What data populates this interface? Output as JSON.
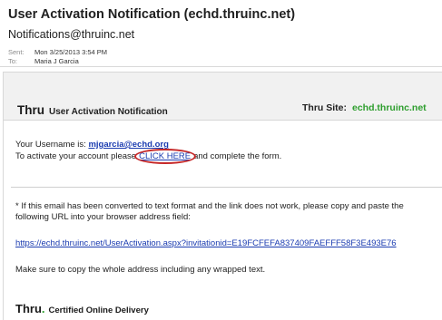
{
  "email": {
    "subject": "User Activation Notification (echd.thruinc.net)",
    "from": "Notifications@thruinc.net",
    "sent_label": "Sent:",
    "sent_value": "Mon 3/25/2013 3:54 PM",
    "to_label": "To:",
    "to_value": "Maria J Garcia"
  },
  "message": {
    "brand_logo": "Thru",
    "brand_title": "User Activation Notification",
    "site_label": "Thru Site:",
    "site_value": "echd.thruinc.net",
    "username_label": "Your Username is:",
    "username_value": "mjgarcia@echd.org",
    "activate_prefix": "To activate your account please",
    "click_here": "CLICK HERE",
    "activate_suffix": "and complete the form.",
    "note_line1": "* If this email has been converted to text format and the link does not work, please copy and paste the",
    "note_line2": "following URL into your browser address field:",
    "activation_url": "https://echd.thruinc.net/UserActivation.aspx?invitationid=E19FCFEFA837409FAEFFF58F3E493E76",
    "copy_note": "Make sure to copy the whole address including any wrapped text.",
    "footer_logo": "Thru",
    "footer_dot": ".",
    "footer_text": "Certified Online Delivery"
  },
  "colors": {
    "link": "#1a3bb0",
    "site_green": "#2e9e2e",
    "circle_red": "#c62828"
  }
}
